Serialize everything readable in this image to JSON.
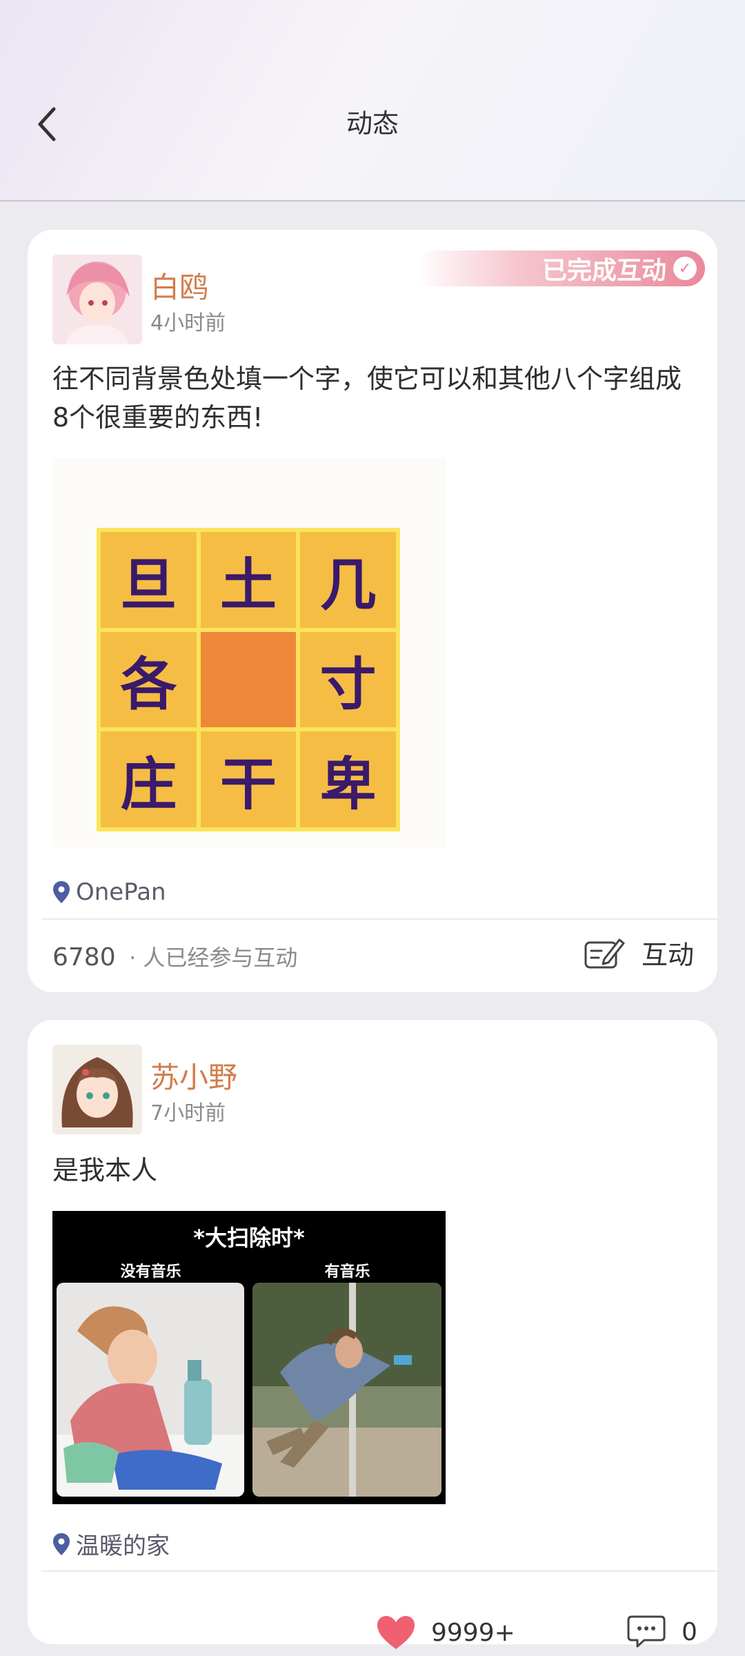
{
  "header": {
    "title": "动态"
  },
  "posts": [
    {
      "user": "白鸥",
      "time": "4小时前",
      "badge": "已完成互动",
      "text": "往不同背景色处填一个字，使它可以和其他八个字组成8个很重要的东西!",
      "puzzle": [
        "旦",
        "土",
        "几",
        "各",
        "",
        "寸",
        "庄",
        "干",
        "卑"
      ],
      "location": "OnePan",
      "participants_count": "6780",
      "participants_label": "· 人已经参与互动",
      "action_label": "互动"
    },
    {
      "user": "苏小野",
      "time": "7小时前",
      "text": "是我本人",
      "meme": {
        "title": "*大扫除时*",
        "left": "没有音乐",
        "right": "有音乐"
      },
      "location": "温暖的家",
      "likes": "9999+",
      "comments": "0"
    }
  ],
  "colors": {
    "username": "#d27d4c",
    "accent_pink": "#e9899b",
    "puzzle_bg": "#f6bd45",
    "puzzle_center": "#ee8738",
    "puzzle_text": "#3a1a6a"
  },
  "icons": [
    "back-arrow-icon",
    "check-icon",
    "location-pin-icon",
    "edit-note-icon",
    "heart-icon",
    "comment-icon"
  ]
}
